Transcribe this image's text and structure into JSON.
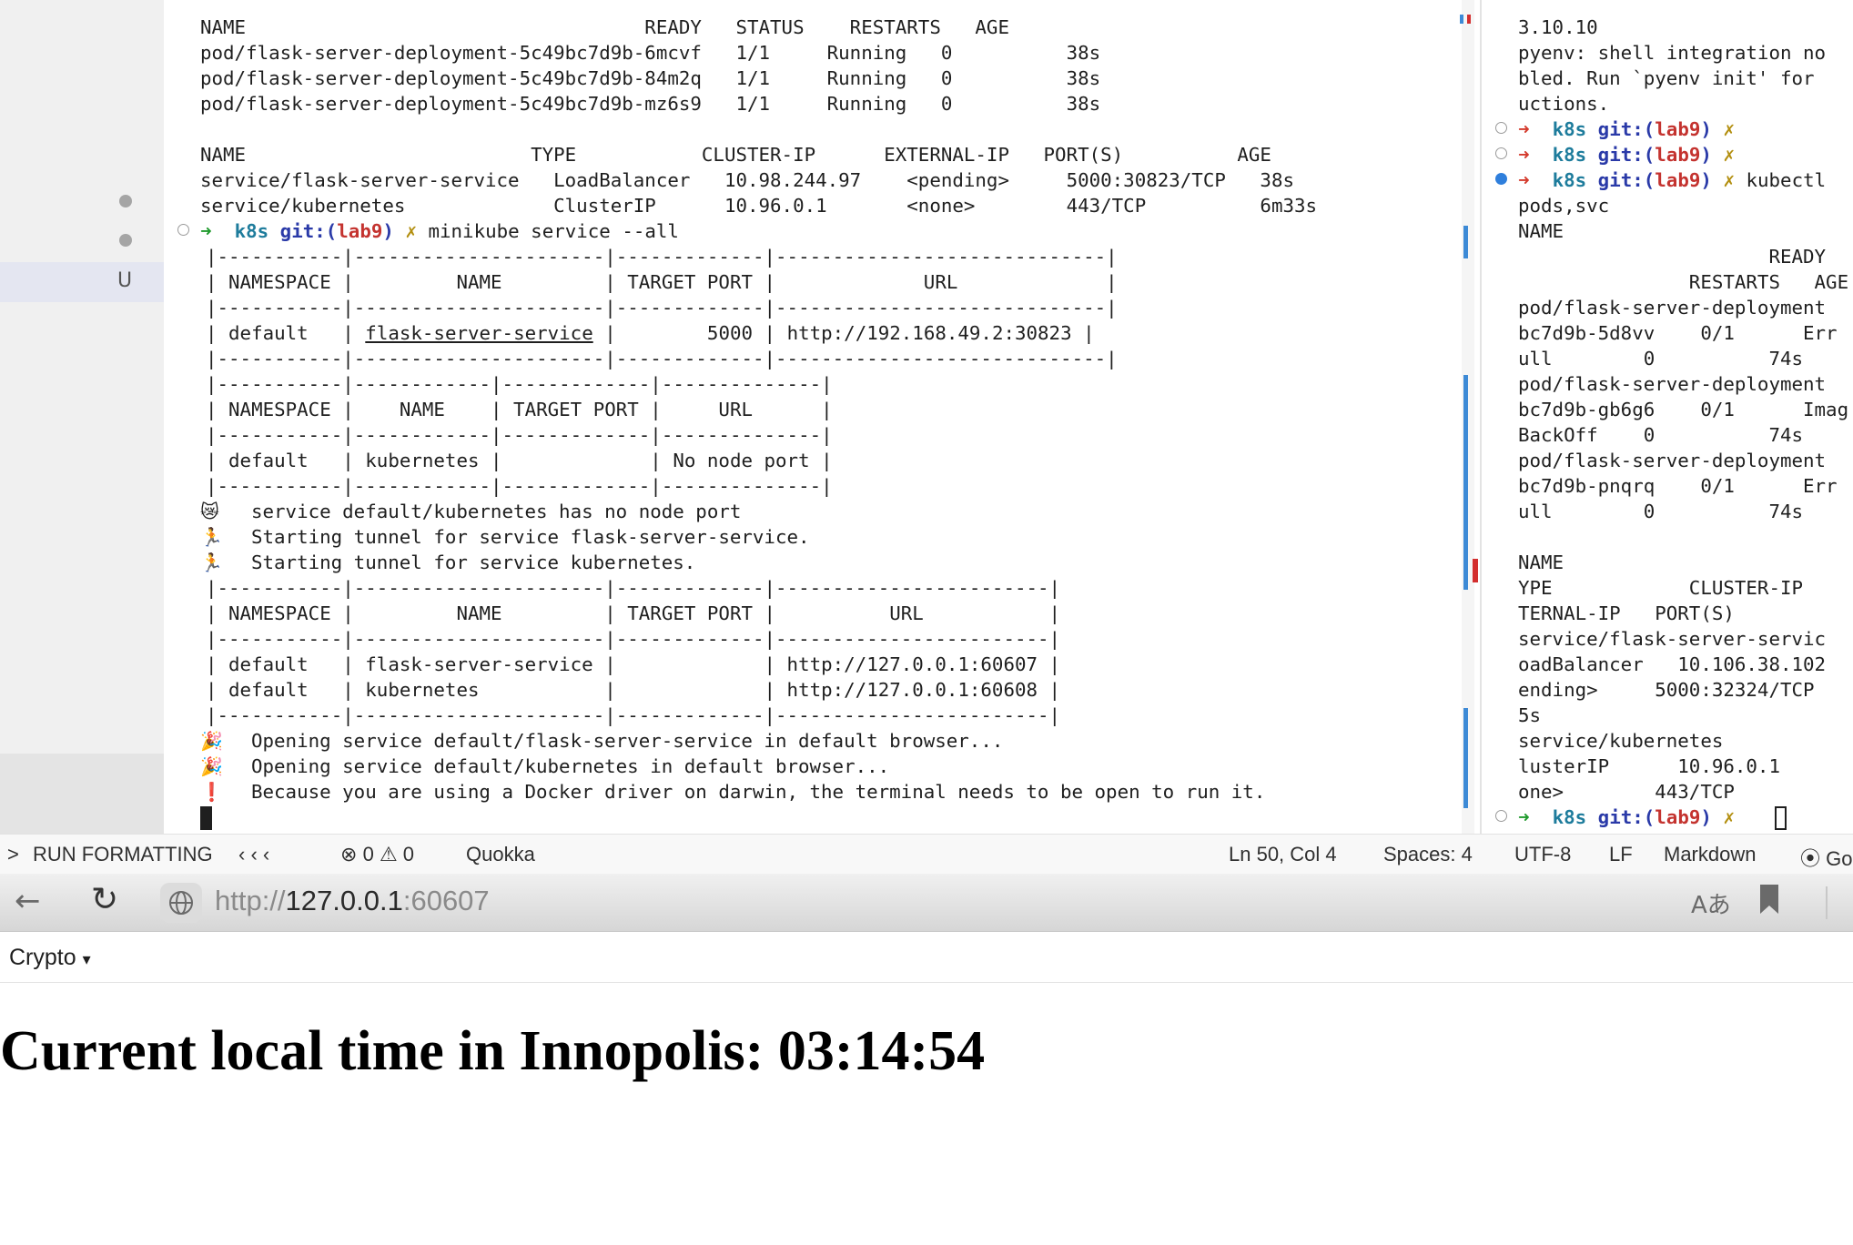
{
  "terminal_main": {
    "pods_header": "NAME                                   READY   STATUS    RESTARTS   AGE",
    "pods": [
      "pod/flask-server-deployment-5c49bc7d9b-6mcvf   1/1     Running   0          38s",
      "pod/flask-server-deployment-5c49bc7d9b-84m2q   1/1     Running   0          38s",
      "pod/flask-server-deployment-5c49bc7d9b-mz6s9   1/1     Running   0          38s"
    ],
    "svc_header": "NAME                         TYPE           CLUSTER-IP      EXTERNAL-IP   PORT(S)          AGE",
    "services": [
      "service/flask-server-service   LoadBalancer   10.98.244.97    <pending>     5000:30823/TCP   38s",
      "service/kubernetes             ClusterIP      10.96.0.1       <none>        443/TCP          6m33s"
    ],
    "prompt": {
      "arrow": "➜",
      "dir": "k8s",
      "git_label": "git:(",
      "branch": "lab9",
      "git_close": ")",
      "dirty": "✗",
      "command": "minikube service --all"
    },
    "table1": {
      "border": "|-----------|----------------------|-------------|-----------------------------|",
      "header": "| NAMESPACE |         NAME         | TARGET PORT |             URL             |",
      "row_ns": "| default   | ",
      "row_name": "flask-server-service",
      "row_rest": " |        5000 | http://192.168.49.2:30823 |"
    },
    "table2": {
      "border": "|-----------|------------|-------------|--------------|",
      "header": "| NAMESPACE |    NAME    | TARGET PORT |     URL      |",
      "row": "| default   | kubernetes |             | No node port |"
    },
    "messages": [
      {
        "icon": "😿",
        "text": "service default/kubernetes has no node port"
      },
      {
        "icon": "🏃",
        "text": "Starting tunnel for service flask-server-service."
      },
      {
        "icon": "🏃",
        "text": "Starting tunnel for service kubernetes."
      }
    ],
    "table3": {
      "border": "|-----------|----------------------|-------------|------------------------|",
      "header": "| NAMESPACE |         NAME         | TARGET PORT |          URL           |",
      "rows": [
        "| default   | flask-server-service |             | http://127.0.0.1:60607 |",
        "| default   | kubernetes           |             | http://127.0.0.1:60608 |"
      ]
    },
    "opening": [
      {
        "icon": "🎉",
        "text": "Opening service default/flask-server-service in default browser..."
      },
      {
        "icon": "🎉",
        "text": "Opening service default/kubernetes in default browser..."
      },
      {
        "icon": "❗",
        "text": "Because you are using a Docker driver on darwin, the terminal needs to be open to run it."
      }
    ]
  },
  "terminal_side": {
    "lines_top": [
      "3.10.10",
      "pyenv: shell integration no",
      "bled. Run `pyenv init' for",
      "uctions."
    ],
    "prompt": {
      "arrow": "➜",
      "dir": "k8s",
      "git_label": "git:(",
      "branch": "lab9",
      "git_close": ")",
      "dirty": "✗",
      "command_tail": "kubectl"
    },
    "lines_output": [
      "pods,svc",
      "NAME",
      "                      READY   STAT",
      "               RESTARTS   AGE",
      "pod/flask-server-deployment",
      "bc7d9b-5d8vv    0/1      Err",
      "ull        0          74s",
      "pod/flask-server-deployment",
      "bc7d9b-gb6g6    0/1      Imag",
      "BackOff    0          74s",
      "pod/flask-server-deployment",
      "bc7d9b-pnqrq    0/1      Err",
      "ull        0          74s",
      "",
      "NAME",
      "YPE            CLUSTER-IP",
      "TERNAL-IP   PORT(S)",
      "service/flask-server-servic",
      "oadBalancer   10.106.38.102",
      "ending>     5000:32324/TCP",
      "5s",
      "service/kubernetes",
      "lusterIP      10.96.0.1",
      "one>        443/TCP"
    ]
  },
  "gutter": {
    "modified_badge": "U"
  },
  "statusbar": {
    "chevron": ">",
    "run_formatting": "RUN FORMATTING",
    "nav_arrows": "‹ ‹ ‹",
    "errors": "0",
    "warnings": "0",
    "quokka": "Quokka",
    "position": "Ln 50, Col 4",
    "spaces": "Spaces: 4",
    "encoding": "UTF-8",
    "eol": "LF",
    "language": "Markdown",
    "golive": "Go"
  },
  "browser": {
    "url_scheme": "http://",
    "url_host": "127.0.0.1",
    "url_port": ":60607",
    "bookmark_folder": "Crypto",
    "bookmark_caret": "▾",
    "heading": "Current local time in Innopolis: 03:14:54"
  },
  "colors": {
    "accent_blue": "#3d8ad6",
    "prompt_red": "#d43a2c",
    "k8s_teal": "#1e7c9c"
  }
}
